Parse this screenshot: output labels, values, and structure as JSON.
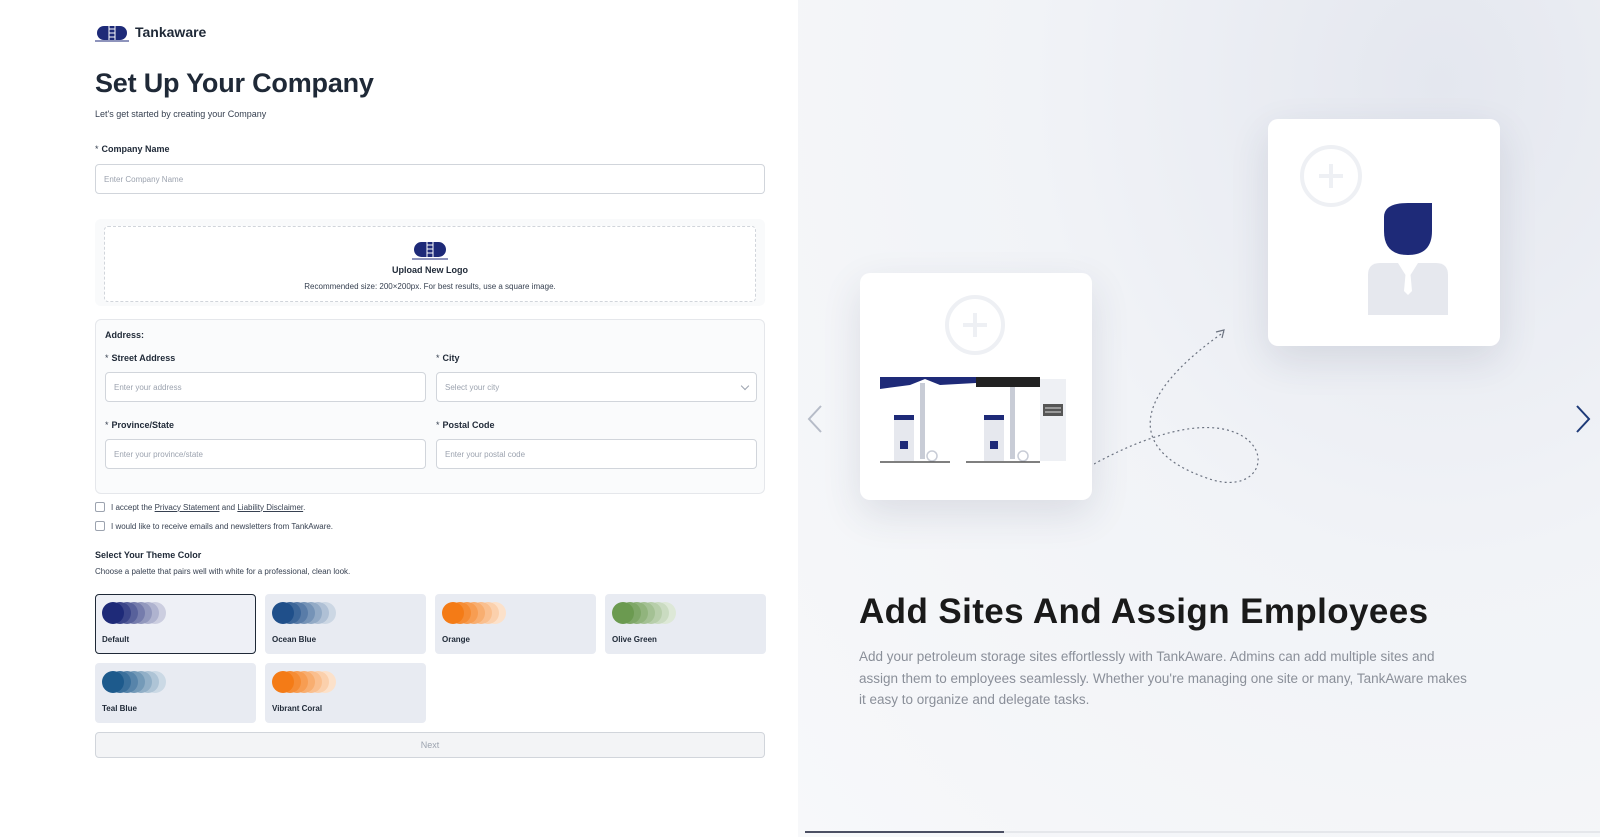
{
  "brand": {
    "name": "Tankaware",
    "logo_icon": "fuel-tank-icon"
  },
  "page": {
    "title": "Set Up Your Company",
    "subtitle": "Let's get started by creating your Company"
  },
  "company": {
    "label": "Company Name",
    "required_mark": "*",
    "placeholder": "Enter Company Name",
    "value": ""
  },
  "upload": {
    "icon": "fuel-tank-icon",
    "title": "Upload New Logo",
    "hint": "Recommended size: 200×200px. For best results, use a square image."
  },
  "address": {
    "title": "Address:",
    "street": {
      "label": "Street Address",
      "placeholder": "Enter your address"
    },
    "city": {
      "label": "City",
      "placeholder": "Select your city"
    },
    "province": {
      "label": "Province/State",
      "placeholder": "Enter your province/state"
    },
    "postal": {
      "label": "Postal Code",
      "placeholder": "Enter your postal code"
    }
  },
  "agreements": {
    "terms_prefix": "I accept the",
    "privacy_link": "Privacy Statement",
    "and": "and",
    "liability_link": "Liability Disclaimer",
    "terms_suffix": ".",
    "newsletter": "I would like to receive emails and newsletters from TankAware."
  },
  "theme": {
    "title": "Select Your Theme Color",
    "subtitle": "Choose a palette that pairs well with white for a professional, clean look.",
    "selected": "Default",
    "palettes": [
      {
        "name": "Default",
        "base": "#1e2a78"
      },
      {
        "name": "Ocean Blue",
        "base": "#1f4f8a"
      },
      {
        "name": "Orange",
        "base": "#f47b16"
      },
      {
        "name": "Olive Green",
        "base": "#6b9a50"
      },
      {
        "name": "Teal Blue",
        "base": "#1d5a8c"
      },
      {
        "name": "Vibrant Coral",
        "base": "#f47b16"
      }
    ]
  },
  "next_button": "Next",
  "slide": {
    "title": "Add Sites And Assign Employees",
    "description": "Add your petroleum storage sites effortlessly with TankAware. Admins can add multiple sites and assign them to employees seamlessly. Whether you're managing one site or many, TankAware makes it easy to organize and delegate tasks.",
    "progress": 0.25,
    "prev_icon": "chevron-left-icon",
    "next_icon": "chevron-right-icon"
  },
  "colors": {
    "brand_navy": "#1e2a78",
    "text_dark": "#1f2937",
    "muted": "#9ca3af"
  }
}
